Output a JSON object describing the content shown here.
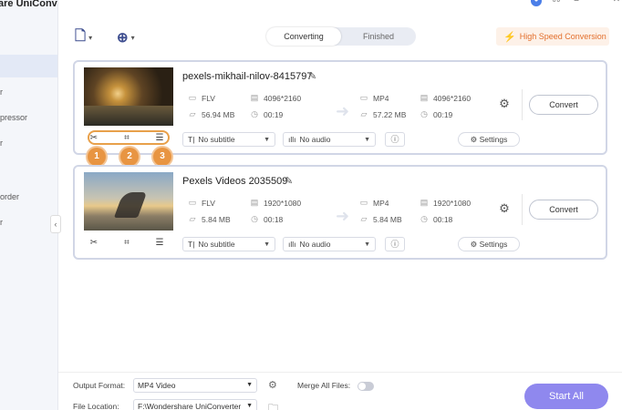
{
  "app": {
    "title": "are UniConverter"
  },
  "sidebar": {
    "items": [
      "r",
      "pressor",
      "r",
      "",
      "order",
      "r"
    ]
  },
  "toolbar": {
    "add_files_icon": "add-file-icon",
    "add_media_icon": "add-media-icon",
    "tabs": [
      "Converting",
      "Finished"
    ],
    "high_speed_label": "High Speed Conversion"
  },
  "files": [
    {
      "name": "pexels-mikhail-nilov-8415797",
      "source": {
        "format": "FLV",
        "resolution": "4096*2160",
        "size": "56.94 MB",
        "duration": "00:19"
      },
      "target": {
        "format": "MP4",
        "resolution": "4096*2160",
        "size": "57.22 MB",
        "duration": "00:19"
      },
      "subtitle": "No subtitle",
      "audio": "No audio",
      "settings_label": "Settings",
      "convert_label": "Convert",
      "badges": [
        "1",
        "2",
        "3"
      ]
    },
    {
      "name": "Pexels Videos 2035509",
      "source": {
        "format": "FLV",
        "resolution": "1920*1080",
        "size": "5.84 MB",
        "duration": "00:18"
      },
      "target": {
        "format": "MP4",
        "resolution": "1920*1080",
        "size": "5.84 MB",
        "duration": "00:18"
      },
      "subtitle": "No subtitle",
      "audio": "No audio",
      "settings_label": "Settings",
      "convert_label": "Convert"
    }
  ],
  "footer": {
    "output_format_label": "Output Format:",
    "output_format_value": "MP4 Video",
    "merge_label": "Merge All Files:",
    "file_location_label": "File Location:",
    "file_location_value": "F:\\Wondershare UniConverter",
    "start_all_label": "Start All"
  },
  "colors": {
    "accent": "#8f88ee",
    "highlight": "#e89542",
    "speed": "#e36f2c"
  }
}
